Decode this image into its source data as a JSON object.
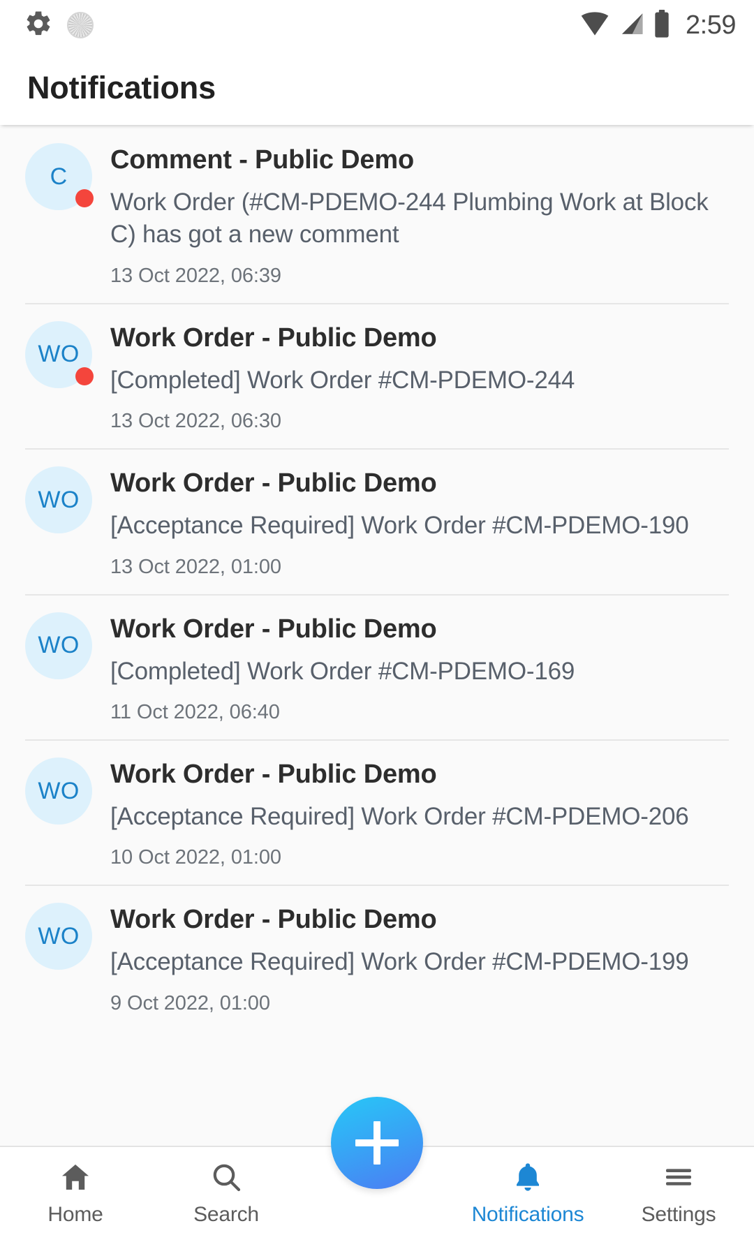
{
  "status_bar": {
    "time": "2:59",
    "left_icons": [
      "gear-icon",
      "loading-spinner-icon"
    ],
    "right_icons": [
      "wifi-icon",
      "cellular-signal-icon",
      "battery-icon"
    ]
  },
  "app_bar": {
    "title": "Notifications"
  },
  "colors": {
    "accent": "#1d87d4",
    "avatar_bg": "#ddf1fc",
    "avatar_text": "#1b82c8",
    "unread_dot": "#f4453c",
    "fab_gradient_start": "#28c7f7",
    "fab_gradient_end": "#4c7cf4",
    "list_bg": "#fafafa"
  },
  "notifications": [
    {
      "avatar": "C",
      "title": "Comment - Public Demo",
      "message": "Work Order (#CM-PDEMO-244 Plumbing Work at Block C) has got a new comment",
      "time": "13 Oct 2022, 06:39",
      "unread": true
    },
    {
      "avatar": "WO",
      "title": "Work Order - Public Demo",
      "message": "[Completed] Work Order #CM-PDEMO-244",
      "time": "13 Oct 2022, 06:30",
      "unread": true
    },
    {
      "avatar": "WO",
      "title": "Work Order - Public Demo",
      "message": "[Acceptance Required] Work Order #CM-PDEMO-190",
      "time": "13 Oct 2022, 01:00",
      "unread": false
    },
    {
      "avatar": "WO",
      "title": "Work Order - Public Demo",
      "message": "[Completed] Work Order #CM-PDEMO-169",
      "time": "11 Oct 2022, 06:40",
      "unread": false
    },
    {
      "avatar": "WO",
      "title": "Work Order - Public Demo",
      "message": "[Acceptance Required] Work Order #CM-PDEMO-206",
      "time": "10 Oct 2022, 01:00",
      "unread": false
    },
    {
      "avatar": "WO",
      "title": "Work Order - Public Demo",
      "message": "[Acceptance Required] Work Order #CM-PDEMO-199",
      "time": "9 Oct 2022, 01:00",
      "unread": false
    }
  ],
  "bottom_nav": {
    "items": [
      {
        "label": "Home",
        "icon": "home-icon",
        "active": false
      },
      {
        "label": "Search",
        "icon": "search-icon",
        "active": false
      },
      {
        "label": "Notifications",
        "icon": "bell-icon",
        "active": true
      },
      {
        "label": "Settings",
        "icon": "menu-icon",
        "active": false
      }
    ],
    "fab": {
      "icon": "plus-icon",
      "label": "+"
    }
  }
}
